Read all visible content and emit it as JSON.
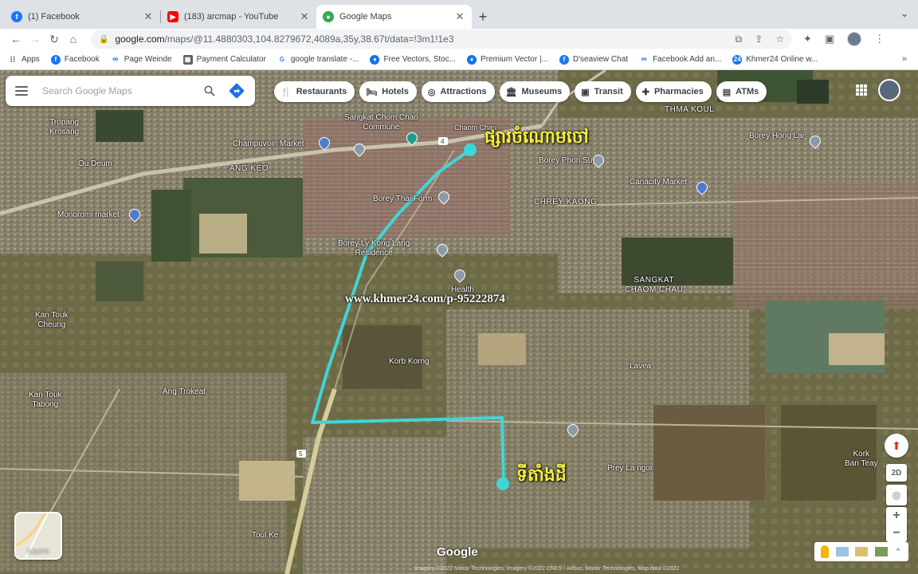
{
  "browser": {
    "tabs": [
      {
        "title": "(1) Facebook",
        "icon": "facebook-icon",
        "color": "#1877f2",
        "active": false
      },
      {
        "title": "(183) arcmap - YouTube",
        "icon": "youtube-icon",
        "color": "#ff0000",
        "active": false
      },
      {
        "title": "Google Maps",
        "icon": "google-maps-icon",
        "color": "#34a853",
        "active": true
      }
    ],
    "url_host": "google.com",
    "url_path": "/maps/@11.4880303,104.8279672,4089a,35y,38.67t/data=!3m1!1e3",
    "bookmarks": [
      {
        "label": "Apps",
        "icon": "apps-icon",
        "color": "#5f6368"
      },
      {
        "label": "Facebook",
        "icon": "facebook-icon",
        "color": "#1877f2"
      },
      {
        "label": "Page Weinde",
        "icon": "meta-icon",
        "color": "#0668e1"
      },
      {
        "label": "Payment Calculator",
        "icon": "calculator-icon",
        "color": "#5f6368"
      },
      {
        "label": "google translate -...",
        "icon": "google-icon",
        "color": "#4285f4"
      },
      {
        "label": "Free Vectors, Stoc...",
        "icon": "freepik-icon",
        "color": "#1273eb"
      },
      {
        "label": "Premium Vector |...",
        "icon": "freepik-icon",
        "color": "#1273eb"
      },
      {
        "label": "D'seaview Chat",
        "icon": "facebook-icon",
        "color": "#1877f2"
      },
      {
        "label": "Facebook Add an...",
        "icon": "meta-icon",
        "color": "#0668e1"
      },
      {
        "label": "Khmer24 Online w...",
        "icon": "khmer24-icon",
        "color": "#1a73e8"
      }
    ]
  },
  "maps": {
    "search_placeholder": "Search Google Maps",
    "chips": [
      {
        "label": "Restaurants",
        "icon": "restaurant-icon",
        "glyph": "🍴"
      },
      {
        "label": "Hotels",
        "icon": "hotel-icon",
        "glyph": "🛏"
      },
      {
        "label": "Attractions",
        "icon": "attraction-icon",
        "glyph": "◎"
      },
      {
        "label": "Museums",
        "icon": "museum-icon",
        "glyph": "🏛"
      },
      {
        "label": "Transit",
        "icon": "transit-icon",
        "glyph": "▣"
      },
      {
        "label": "Pharmacies",
        "icon": "pharmacy-icon",
        "glyph": "✚"
      },
      {
        "label": "ATMs",
        "icon": "atm-icon",
        "glyph": "▤"
      }
    ],
    "labels": {
      "tropang_krosang": "Tropang\nKrosang",
      "champuvoin": "Champuvoin Market",
      "chom_chau": "Sangkat Chom Chao\nCommune",
      "chaom_chau": "Chaom Chau",
      "thma_kouel": "THMA KOUL",
      "borey_hong_lai": "Borey Hong Lai",
      "ou_deum": "Ou Deum",
      "ang_keo": "ANG KEO",
      "borey_phon_suy": "Borey Phon Suy",
      "borey_thai": "Borey Thai Form",
      "canacity": "Canacity Market",
      "chrey_kaong": "CHREY KAONG",
      "monorom": "Monoromi market",
      "borey_kong": "Borey Ly Kong Lang\nResidence",
      "health": "Health",
      "sangkat_chaom_chau": "SANGKAT\nCHAOM CHAU",
      "kan_touk_cheung": "Kan Touk\nCheung",
      "korb_korng": "Korb Korng",
      "kan_touk_tabong": "Kan Touk\nTabong",
      "ang_trokeat": "Ang Trokeat",
      "lavea": "Lavea",
      "kork_ban_teay": "Kork\nBan Teay",
      "prey_la_ngor": "Prey La ngor",
      "toul_ke": "Toul Ke",
      "route_5": "5",
      "route_4": "4"
    },
    "watermark": "www.khmer24.com/p-95222874",
    "khmer_start": "ផ្សារចំណោមចៅ",
    "khmer_end": "ទីតាំងដី",
    "layers_label": "Layers",
    "google_logo": "Google",
    "attribution": "Imagery ©2022 Maxar Technologies, Imagery ©2022 CNES / Airbus, Maxar Technologies, Map data ©2022",
    "compass_2d": "2D",
    "route_color": "#3fd6d6"
  }
}
